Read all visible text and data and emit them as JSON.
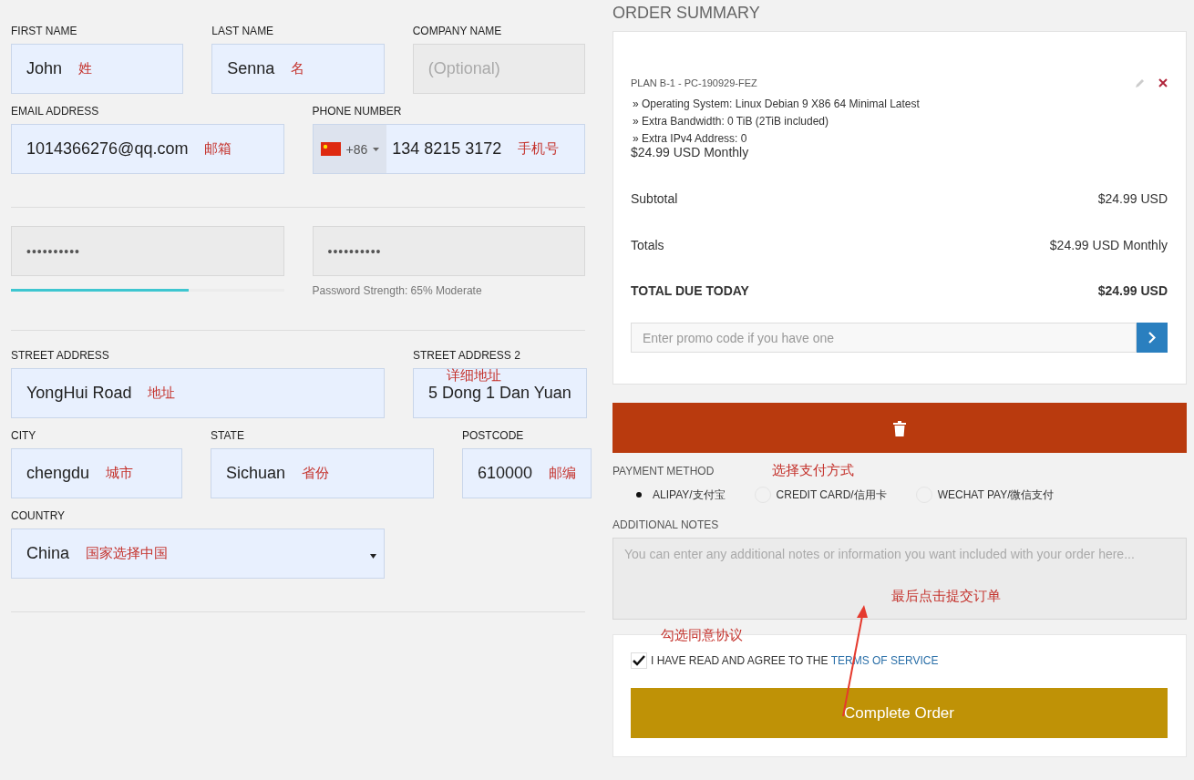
{
  "form": {
    "rows": [
      {
        "fields": [
          {
            "kind": "text",
            "label": "FIRST NAME",
            "value": "John",
            "note": "姓",
            "autofilled": true
          },
          {
            "kind": "text",
            "label": "LAST NAME",
            "value": "Senna",
            "note": "名",
            "autofilled": true
          },
          {
            "kind": "text",
            "label": "COMPANY NAME",
            "placeholder": "(Optional)",
            "autofilled": false
          }
        ]
      },
      {
        "fields": [
          {
            "kind": "text",
            "label": "EMAIL ADDRESS",
            "value": "1014366276@qq.com",
            "note": "邮箱",
            "autofilled": true
          },
          {
            "kind": "phone",
            "label": "PHONE NUMBER",
            "code": "+86",
            "value": "134 8215 3172",
            "note": "手机号",
            "autofilled": true
          }
        ],
        "divider_after": true
      },
      {
        "fields": [
          {
            "kind": "password",
            "value": "••••••••••",
            "autofilled": false,
            "level": 0.65
          },
          {
            "kind": "password",
            "value": "••••••••••",
            "autofilled": false,
            "hint": "Password Strength: 65% Moderate"
          }
        ],
        "divider_after": true
      },
      {
        "fields": [
          {
            "kind": "text",
            "label": "STREET ADDRESS",
            "value": "YongHui Road",
            "note": "地址",
            "autofilled": true
          },
          {
            "kind": "text",
            "label": "STREET ADDRESS 2",
            "value": "5 Dong 1 Dan Yuan",
            "note": "详细地址",
            "note_above": true,
            "autofilled": true
          }
        ]
      },
      {
        "fields": [
          {
            "kind": "text",
            "label": "CITY",
            "value": "chengdu",
            "note": "城市",
            "autofilled": true
          },
          {
            "kind": "text",
            "label": "STATE",
            "value": "Sichuan",
            "note": "省份",
            "autofilled": true
          },
          {
            "kind": "text",
            "label": "POSTCODE",
            "value": "610000",
            "note": "邮编",
            "autofilled": true
          }
        ]
      },
      {
        "fields": [
          {
            "kind": "select",
            "label": "COUNTRY",
            "value": "China",
            "note": "国家选择中国",
            "autofilled": true
          }
        ],
        "divider_after": true
      }
    ]
  },
  "summary": {
    "title": "ORDER SUMMARY",
    "plan": "PLAN B-1 - PC-190929-FEZ",
    "features": [
      "» Operating System: Linux Debian 9 X86 64 Minimal Latest",
      "» Extra Bandwidth: 0 TiB (2TiB included)",
      "» Extra IPv4 Address: 0"
    ],
    "price": "$24.99 USD Monthly",
    "totals": [
      {
        "label": "Subtotal",
        "value": "$24.99 USD",
        "bold": false
      },
      {
        "label": "Totals",
        "value": "$24.99 USD Monthly",
        "bold": false
      },
      {
        "label": "TOTAL DUE TODAY",
        "value": "$24.99 USD",
        "bold": true
      }
    ],
    "promo": {
      "placeholder": "Enter promo code if you have one"
    }
  },
  "payment": {
    "label": "PAYMENT METHOD",
    "note": "选择支付方式",
    "methods": [
      {
        "label": "ALIPAY/支付宝",
        "selected": true
      },
      {
        "label": "CREDIT CARD/信用卡",
        "selected": false
      },
      {
        "label": "WECHAT PAY/微信支付",
        "selected": false
      }
    ]
  },
  "notes": {
    "label": "ADDITIONAL NOTES",
    "placeholder": "You can enter any additional notes or information you want included with your order here...",
    "note": "最后点击提交订单"
  },
  "agree": {
    "note": "勾选同意协议",
    "checked": true,
    "text": "I HAVE READ AND AGREE TO THE",
    "link": "TERMS OF SERVICE"
  },
  "submit": "Complete Order"
}
